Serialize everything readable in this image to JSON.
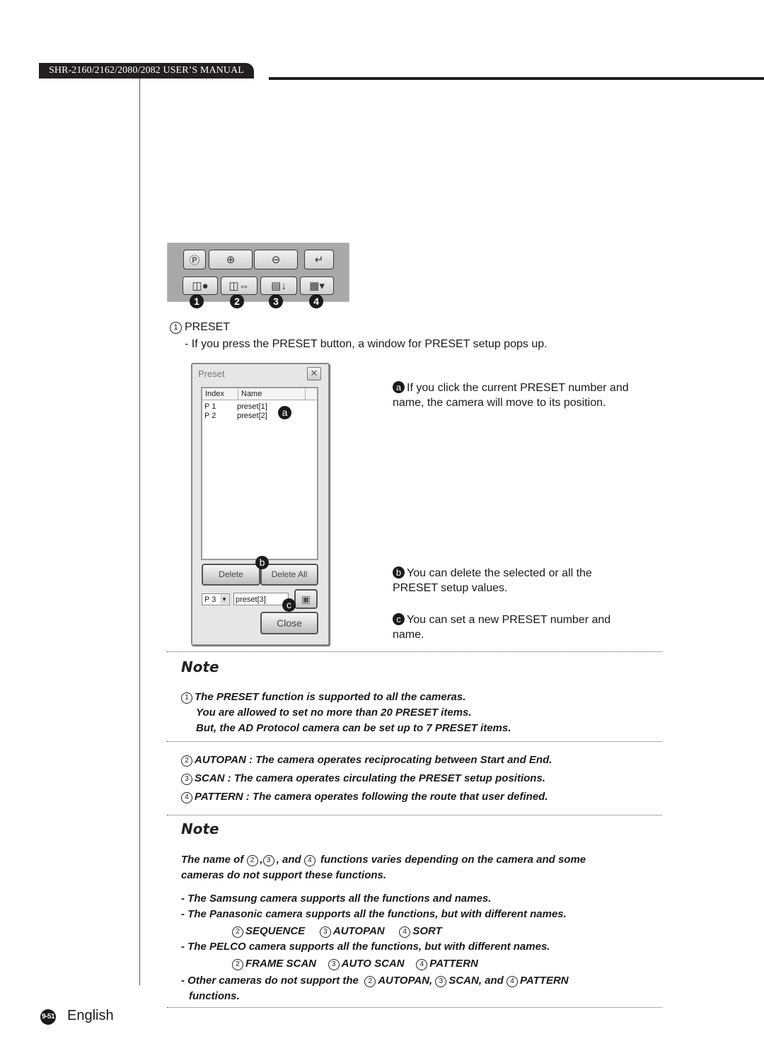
{
  "header": {
    "manual_title": "SHR-2160/2162/2080/2082 USER’S MANUAL"
  },
  "toolbar": {
    "row1": [
      {
        "icon": "preset-zoom-icon",
        "glyph": "Ⓟ"
      },
      {
        "icon": "zoom-in-icon",
        "glyph": "⊕"
      },
      {
        "icon": "zoom-out-icon",
        "glyph": "⊖"
      },
      {
        "icon": "enter-icon",
        "glyph": "↵"
      }
    ],
    "row2": [
      {
        "icon": "preset-view-icon",
        "glyph": "◫●"
      },
      {
        "icon": "autopan-icon",
        "glyph": "◫⇔"
      },
      {
        "icon": "scan-list-icon",
        "glyph": "▤↓"
      },
      {
        "icon": "pattern-icon",
        "glyph": "▦▾"
      }
    ],
    "numbers": [
      "1",
      "2",
      "3",
      "4"
    ]
  },
  "section": {
    "num": "1",
    "title": "PRESET",
    "description": "- If you press the PRESET button, a window for PRESET setup pops up."
  },
  "dialog": {
    "title": "Preset",
    "close_glyph": "✕",
    "columns": [
      "Index",
      "Name"
    ],
    "rows": [
      {
        "index": "P 1",
        "name": "preset[1]"
      },
      {
        "index": "P 2",
        "name": "preset[2]"
      }
    ],
    "delete_label": "Delete",
    "delete_all_label": "Delete All",
    "select_value": "P 3",
    "select_arrow": "▼",
    "name_value": "preset[3]",
    "save_glyph": "💾",
    "close_label": "Close",
    "labels": {
      "a": "a",
      "b": "b",
      "c": "c"
    }
  },
  "annotations": {
    "a": {
      "badge": "a",
      "text": "If you click the current PRESET number and name, the camera will move to its position."
    },
    "b": {
      "badge": "b",
      "text": "You can delete the selected or all the PRESET setup values."
    },
    "c": {
      "badge": "c",
      "text": "You can set a new PRESET number and name."
    }
  },
  "note1": {
    "heading": "Note",
    "item1_num": "1",
    "item1_lines": [
      "The PRESET function is supported to all the cameras.",
      "You are allowed to set no more than 20 PRESET items.",
      "But, the AD Protocol camera can be set up to 7 PRESET items."
    ],
    "items": [
      {
        "num": "2",
        "text": "AUTOPAN : The camera operates reciprocating between Start and End."
      },
      {
        "num": "3",
        "text": "SCAN : The camera operates circulating the PRESET setup positions."
      },
      {
        "num": "4",
        "text": "PATTERN : The camera operates following the route that user defined."
      }
    ]
  },
  "note2": {
    "heading": "Note",
    "intro_a": "The name of",
    "intro_n2": "2",
    "intro_n3": "3",
    "intro_n4": "4",
    "intro_b": "functions varies depending on the camera and some",
    "intro_c": "cameras do not support these functions.",
    "samsung": "- The Samsung camera supports all the functions and names.",
    "panasonic": "- The Panasonic camera supports all the functions, but with different names.",
    "panasonic_names": [
      {
        "num": "2",
        "name": "SEQUENCE"
      },
      {
        "num": "3",
        "name": "AUTOPAN"
      },
      {
        "num": "4",
        "name": "SORT"
      }
    ],
    "pelco": "- The PELCO camera supports all the functions, but with different names.",
    "pelco_names": [
      {
        "num": "2",
        "name": "FRAME SCAN"
      },
      {
        "num": "3",
        "name": "AUTO SCAN"
      },
      {
        "num": "4",
        "name": "PATTERN"
      }
    ],
    "other_a": "- Other cameras do not support the",
    "other_items": [
      {
        "num": "2",
        "name": "AUTOPAN,"
      },
      {
        "num": "3",
        "name": "SCAN, and"
      },
      {
        "num": "4",
        "name": "PATTERN"
      }
    ],
    "other_b": "functions."
  },
  "footer": {
    "page": "9-51",
    "language": "English"
  }
}
